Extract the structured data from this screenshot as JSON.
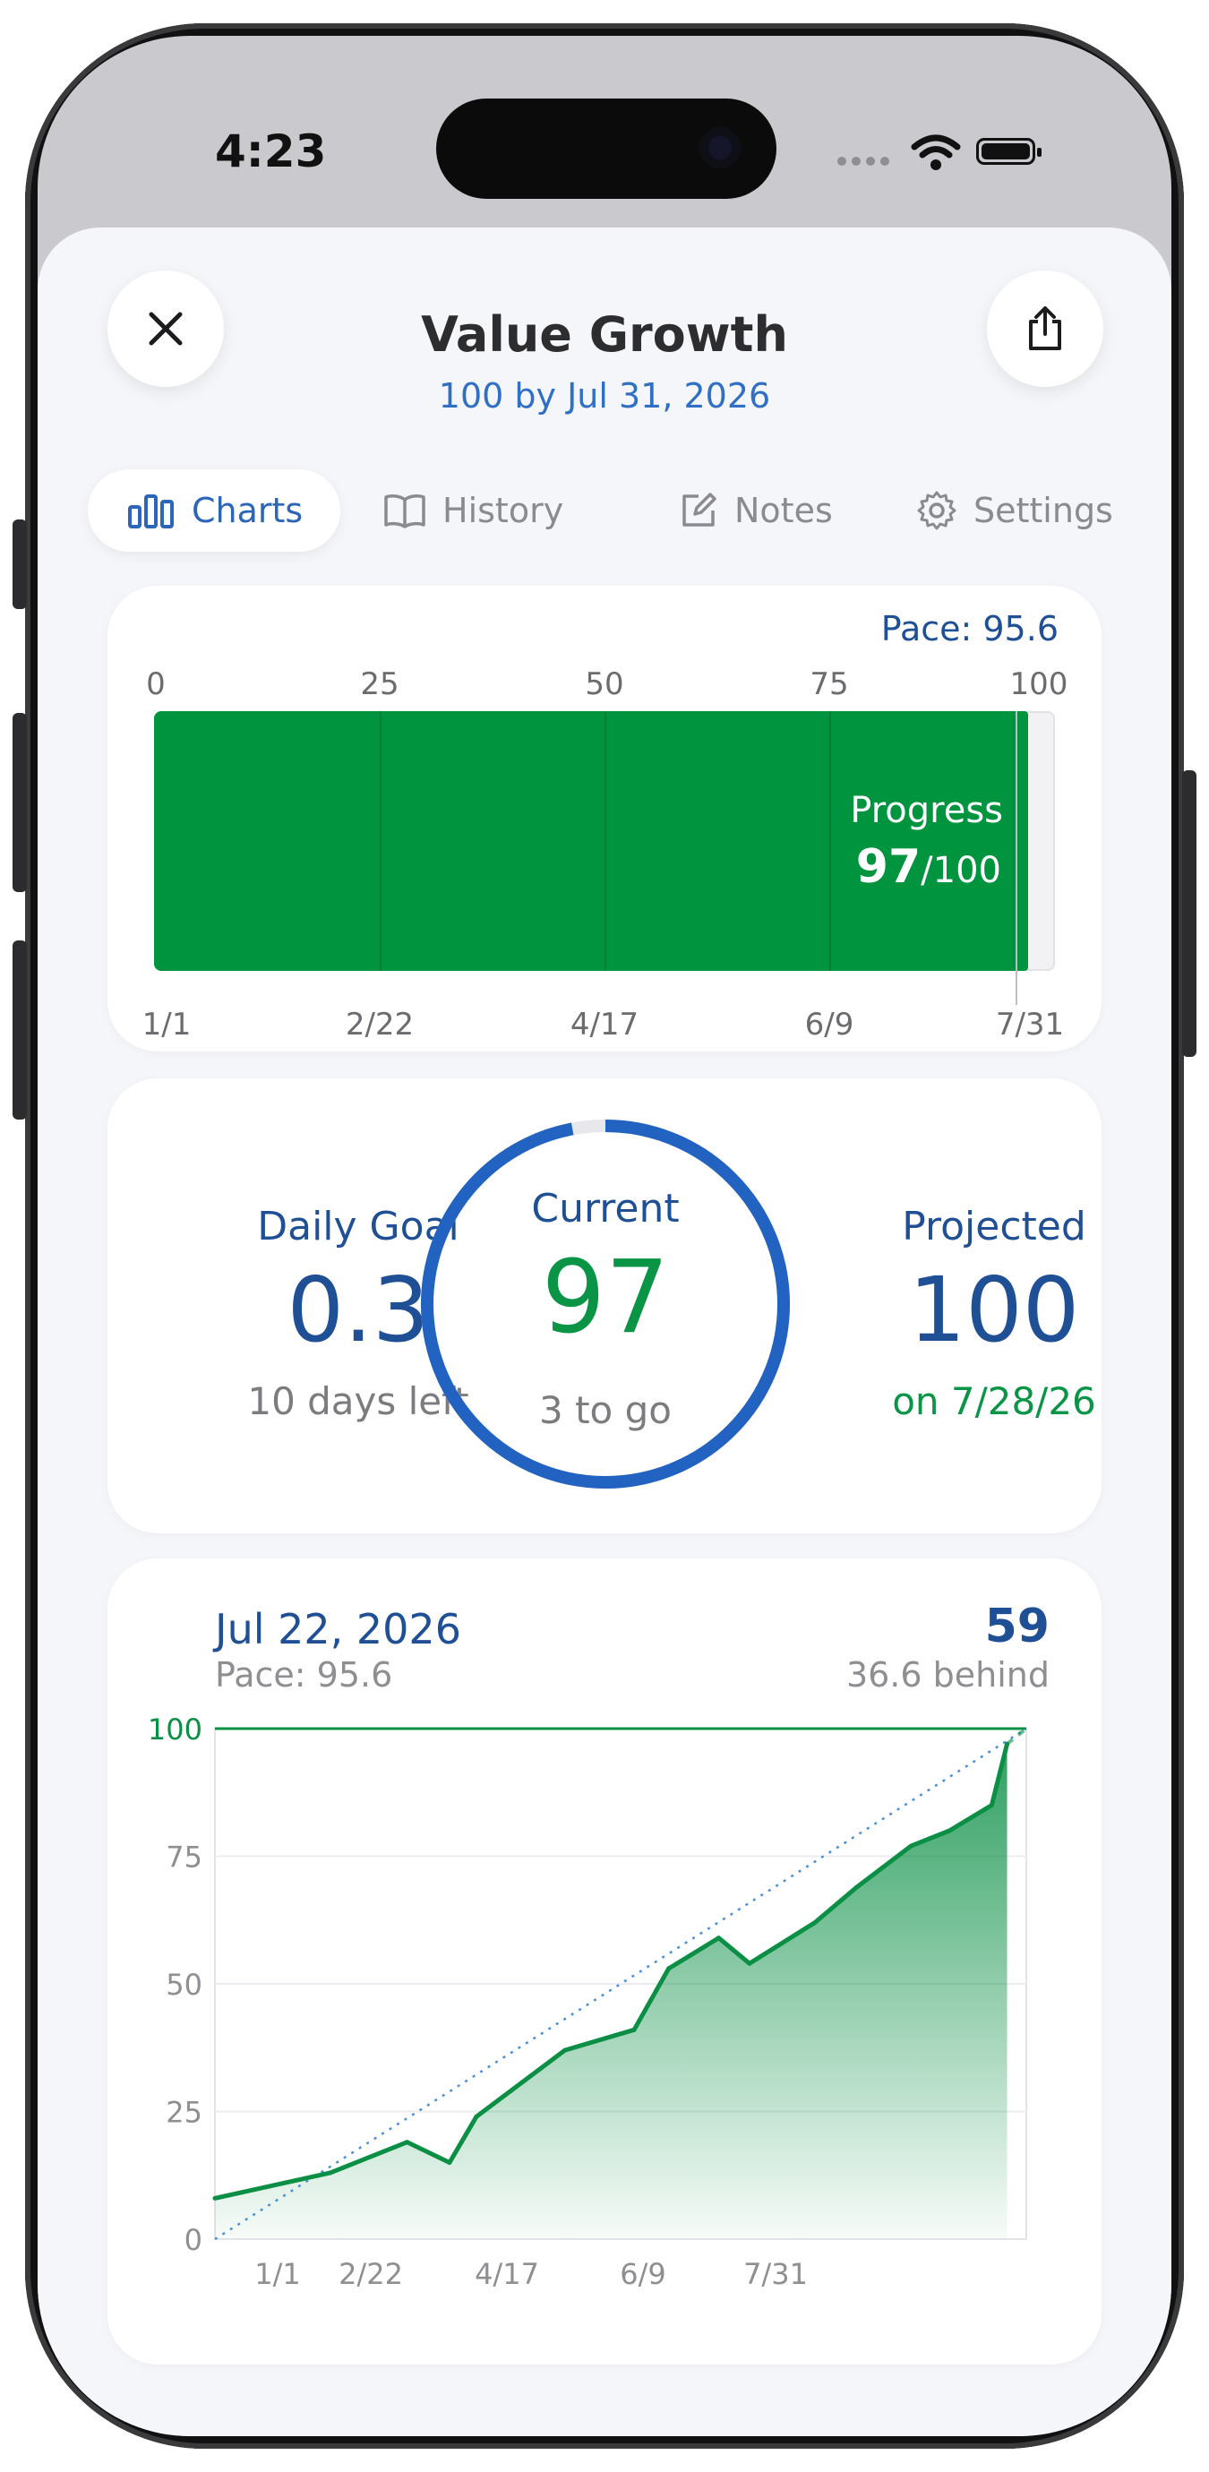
{
  "status_bar": {
    "time": "4:23"
  },
  "header": {
    "title": "Value Growth",
    "subtitle": "100 by Jul 31, 2026"
  },
  "tabs": [
    {
      "label": "Charts",
      "icon": "bar-chart-icon",
      "active": true
    },
    {
      "label": "History",
      "icon": "book-icon",
      "active": false
    },
    {
      "label": "Notes",
      "icon": "edit-icon",
      "active": false
    },
    {
      "label": "Settings",
      "icon": "gear-icon",
      "active": false
    }
  ],
  "progress_card": {
    "pace_label": "Pace: 95.6",
    "scale_ticks": [
      "0",
      "25",
      "50",
      "75",
      "100"
    ],
    "date_ticks": [
      "1/1",
      "2/22",
      "4/17",
      "6/9",
      "7/31"
    ],
    "progress_label": "Progress",
    "current": "97",
    "target": "/100",
    "progress_fraction": 0.97,
    "pace_fraction": 0.956,
    "fill_color": "#00943f"
  },
  "stats_card": {
    "daily_goal_label": "Daily Goal",
    "daily_goal_value": "0.3",
    "days_left": "10 days left",
    "current_label": "Current",
    "current_value": "97",
    "to_go": "3 to go",
    "projected_label": "Projected",
    "projected_value": "100",
    "projected_date": "on 7/28/26",
    "ring_fraction": 0.97,
    "ring_color": "#2262c0",
    "positive_color": "#0a9446"
  },
  "chart_card": {
    "selected_date": "Jul 22, 2026",
    "selected_pace": "Pace: 95.6",
    "selected_value": "59",
    "behind_text": "36.6 behind"
  },
  "chart_data": {
    "type": "area",
    "x_ticks": [
      "1/1",
      "2/22",
      "4/17",
      "6/9",
      "7/31"
    ],
    "y_ticks": [
      "0",
      "25",
      "50",
      "75",
      "100"
    ],
    "ylim": [
      0,
      100
    ],
    "xlim_days": [
      0,
      211
    ],
    "goal_value": 100,
    "pace_line": {
      "from": [
        0,
        0
      ],
      "to": [
        211,
        100
      ]
    },
    "series": [
      {
        "x": [
          0,
          30,
          50,
          61,
          68,
          91,
          109,
          118,
          131,
          139,
          156,
          167,
          181,
          191,
          202,
          216
        ],
        "y": [
          8,
          13,
          19,
          15,
          24,
          37,
          41,
          53,
          59,
          54,
          62,
          69,
          77,
          80,
          85,
          97
        ]
      }
    ],
    "colors": {
      "line": "#0a8f45",
      "goal": "#0a8f45",
      "pace": "#4a90d9"
    }
  }
}
